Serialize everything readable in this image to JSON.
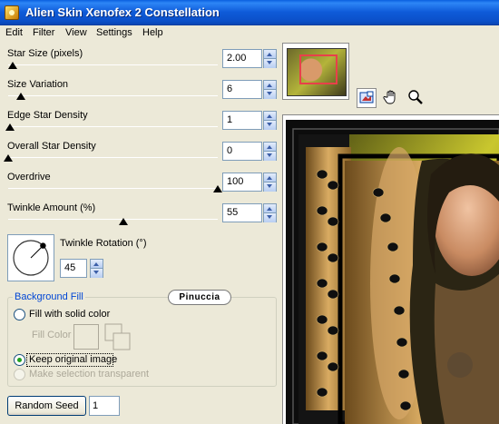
{
  "window": {
    "title": "Alien Skin Xenofex 2 Constellation",
    "app_icon": "app-icon"
  },
  "menu": [
    "Edit",
    "Filter",
    "View",
    "Settings",
    "Help"
  ],
  "controls": [
    {
      "label": "Star Size (pixels)",
      "value": "2.00",
      "level": 0.02
    },
    {
      "label": "Size Variation",
      "value": "6",
      "level": 0.06
    },
    {
      "label": "Edge Star Density",
      "value": "1",
      "level": 0.01
    },
    {
      "label": "Overall Star Density",
      "value": "0",
      "level": 0.0
    },
    {
      "label": "Overdrive",
      "value": "100",
      "level": 1.0
    },
    {
      "label": "Twinkle Amount (%)",
      "value": "55",
      "level": 0.55
    }
  ],
  "rotation": {
    "label": "Twinkle Rotation (°)",
    "value": "45"
  },
  "background_fill": {
    "legend": "Background Fill",
    "options": [
      {
        "label": "Fill with solid color",
        "checked": false,
        "enabled": true
      },
      {
        "label": "Keep original image",
        "checked": true,
        "enabled": true
      },
      {
        "label": "Make selection transparent",
        "checked": false,
        "enabled": false
      }
    ],
    "fill_color_label": "Fill Color"
  },
  "watermark": "Pinuccia",
  "random_seed": {
    "button_label": "Random Seed",
    "value": "1"
  },
  "preview": {
    "tools": [
      "preview-toggle-icon",
      "hand-icon",
      "zoom-icon"
    ]
  },
  "colors": {
    "titlebar": "#0b50c9",
    "accent": "#0046d5",
    "panel": "#ece9d8"
  }
}
